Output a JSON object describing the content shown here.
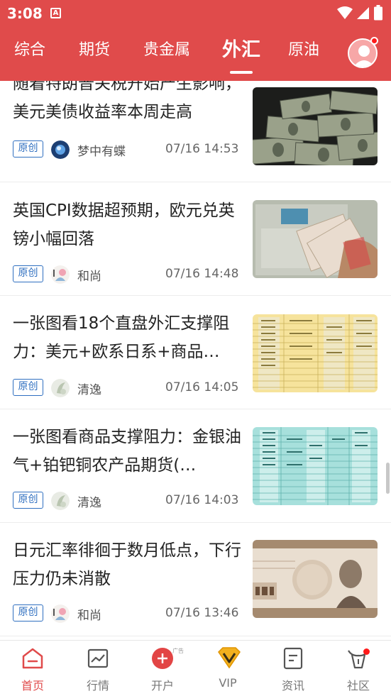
{
  "status_bar": {
    "time": "3:08",
    "app_indicator": "A"
  },
  "tabs": [
    {
      "label": "综合",
      "active": false
    },
    {
      "label": "期货",
      "active": false
    },
    {
      "label": "贵金属",
      "active": false
    },
    {
      "label": "外汇",
      "active": true
    },
    {
      "label": "原油",
      "active": false
    }
  ],
  "articles": [
    {
      "title": "随着特朗普关税开始产生影响，美元美债收益率本周走高",
      "tag": "原创",
      "author": "梦中有蝶",
      "date": "07/16 14:53",
      "thumb_icon": "dollar-bills-image"
    },
    {
      "title": "英国CPI数据超预期，欧元兑英镑小幅回落",
      "tag": "原创",
      "author": "和尚",
      "date": "07/16 14:48",
      "thumb_icon": "money-counter-image"
    },
    {
      "title": "一张图看18个直盘外汇支撑阻力：美元+欧系日系+商品…",
      "tag": "原创",
      "author": "清逸",
      "date": "07/16 14:05",
      "thumb_icon": "yellow-table-image"
    },
    {
      "title": "一张图看商品支撑阻力：金银油气+铂钯铜农产品期货(…",
      "tag": "原创",
      "author": "清逸",
      "date": "07/16 14:03",
      "thumb_icon": "teal-table-image"
    },
    {
      "title": "日元汇率徘徊于数月低点，下行压力仍未消散",
      "tag": "原创",
      "author": "和尚",
      "date": "07/16 13:46",
      "thumb_icon": "yen-banknote-image"
    }
  ],
  "bottom_nav": {
    "items": [
      {
        "label": "首页",
        "icon": "home-icon",
        "active": true
      },
      {
        "label": "行情",
        "icon": "chart-icon",
        "active": false
      },
      {
        "label": "开户",
        "icon": "plus-circle-icon",
        "active": false
      },
      {
        "label": "VIP",
        "icon": "vip-diamond-icon",
        "active": false
      },
      {
        "label": "资讯",
        "icon": "news-icon",
        "active": false
      },
      {
        "label": "社区",
        "icon": "community-icon",
        "active": false
      }
    ],
    "ad_mark": "广告"
  },
  "colors": {
    "brand": "#e04b4b",
    "tag_blue": "#2f6fc0",
    "text": "#222222",
    "muted": "#777777"
  }
}
